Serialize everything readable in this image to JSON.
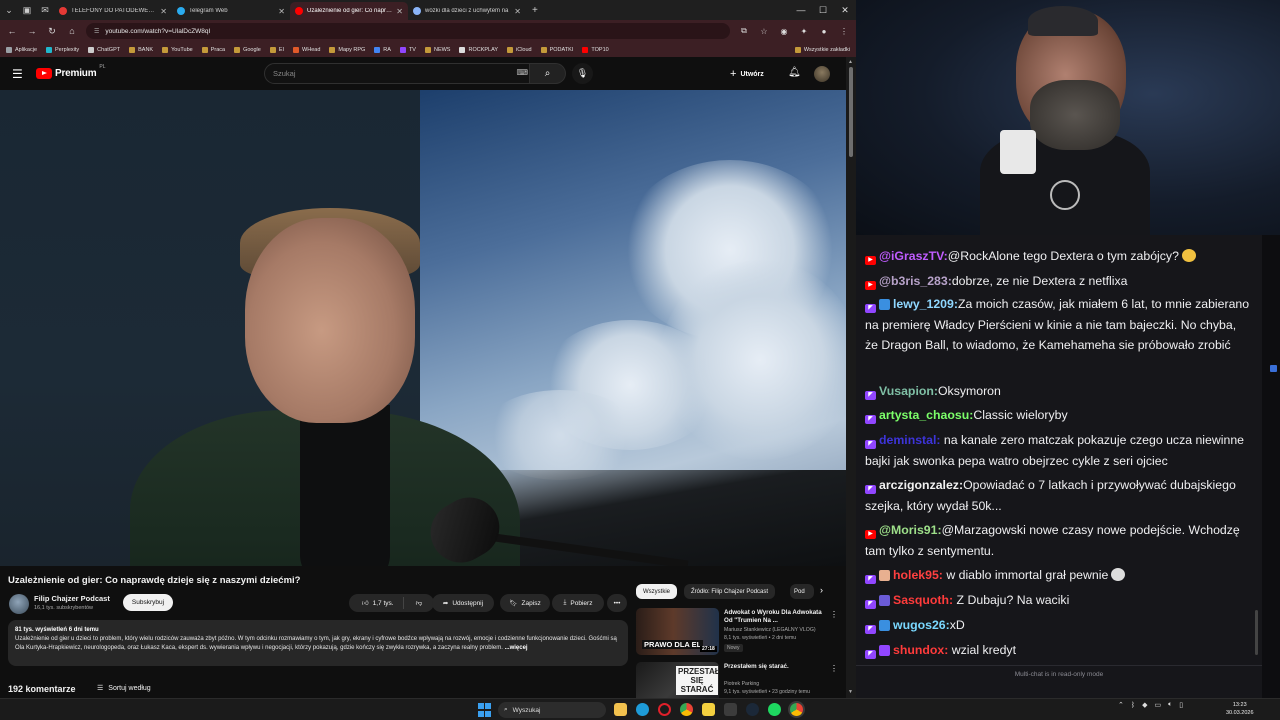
{
  "browser": {
    "tabs": [
      {
        "title": "TELEFONY DO PATODEWELOPERA",
        "color": "#e53935"
      },
      {
        "title": "Telegram Web",
        "color": "#2aabee"
      },
      {
        "title": "Uzależnienie od gier: Co naprawdę",
        "color": "#ff0000"
      },
      {
        "title": "wózki dla dzieci z uchwytem na",
        "color": "#8ab4f8"
      }
    ],
    "url": "youtube.com/watch?v=UlalDcZW8qI",
    "bookmarks": [
      {
        "label": "Aplikacje",
        "color": "#9aa0a6"
      },
      {
        "label": "Perplexity",
        "color": "#20b8cd"
      },
      {
        "label": "ChatGPT",
        "color": "#cccccc"
      },
      {
        "label": "BANK",
        "color": "#c49a3a"
      },
      {
        "label": "YouTube",
        "color": "#c49a3a"
      },
      {
        "label": "Praca",
        "color": "#c49a3a"
      },
      {
        "label": "Google",
        "color": "#c49a3a"
      },
      {
        "label": "EI",
        "color": "#c49a3a"
      },
      {
        "label": "WHead",
        "color": "#e05a2a"
      },
      {
        "label": "Mapy RPG",
        "color": "#c49a3a"
      },
      {
        "label": "RA",
        "color": "#4285f4"
      },
      {
        "label": "TV",
        "color": "#9146ff"
      },
      {
        "label": "NEWS",
        "color": "#c49a3a"
      },
      {
        "label": "ROCKPLAY",
        "color": "#dddddd"
      },
      {
        "label": "iCloud",
        "color": "#c49a3a"
      },
      {
        "label": "PODATKI",
        "color": "#c49a3a"
      },
      {
        "label": "TOP10",
        "color": "#ff0000"
      }
    ],
    "all_bookmarks": "Wszystkie zakładki"
  },
  "youtube": {
    "logo": "Premium",
    "logo_cc": "PL",
    "search_placeholder": "Szukaj",
    "create_label": "Utwórz",
    "video": {
      "title": "Uzależnienie od gier: Co naprawdę dzieje się z naszymi dziećmi?",
      "channel": "Filip Chajzer Podcast",
      "subscribers": "16,1 tys. subskrybentów",
      "subscribe_label": "Subskrybuj",
      "likes": "1,7 tys.",
      "share_label": "Udostępnij",
      "save_label": "Zapisz",
      "download_label": "Pobierz",
      "more_label": "•••",
      "description_meta": "81 tys. wyświetleń  6 dni temu",
      "description_text": "Uzależnienie od gier u dzieci to problem, który wielu rodziców zauważa zbyt późno. W tym odcinku rozmawiamy o tym, jak gry, ekrany i cyfrowe bodźce wpływają na rozwój, emocje i codzienne funkcjonowanie dzieci. Gośćmi są Ola Kurtyka-Hrapkiewicz, neurologopeda, oraz Łukasz Kaca, ekspert ds. wywierania wpływu i negocjacji, którzy pokazują, gdzie kończy się zwykła rozrywka, a zaczyna realny problem.",
      "description_more": "...więcej",
      "comments": "192 komentarze",
      "sort_label": "Sortuj według"
    },
    "chips": [
      "Wszystkie",
      "Źródło: Filip Chajzer Podcast",
      "Pod"
    ],
    "related": [
      {
        "title": "Adwokat o Wyroku Dla Adwokata Od \"Trumien Na ...",
        "channel": "Mariusz Stankiewicz (LEGALNY VLOG)",
        "views": "8,1 tys. wyświetleń  •  2 dni temu",
        "badge": "Nowy",
        "thumb_text": "PRAWO DLA EL",
        "duration": "27:18"
      },
      {
        "title": "Przestałem się starać.",
        "channel": "Piotrek Parking",
        "views": "9,1 tys. wyświetleń  •  23 godziny temu",
        "badge": "",
        "thumb_text": "PRZESTAŁEM SIĘ STARAĆ"
      }
    ]
  },
  "chat": {
    "messages": [
      {
        "platform": "yt",
        "user": "@iGraszTV:",
        "color": "#c05cff",
        "text": "@RockAlone tego Dextera o tym zabójcy?",
        "emote": "#f0c040"
      },
      {
        "platform": "yt",
        "user": "@b3ris_283:",
        "color": "#b7a2c9",
        "text": "dobrze, ze nie Dextera z netflixa"
      },
      {
        "platform": "tw",
        "user": "lewy_1209:",
        "color": "#8fd7ff",
        "text": "Za moich czasów, jak miałem 6 lat, to mnie zabierano na premierę Władcy Pierścieni w kinie a nie tam bajeczki. No chyba, że Dragon Ball, to wiadomo, że Kamehameha sie próbowało zrobić"
      },
      {
        "platform": "tw",
        "user": "Vusapion:",
        "color": "#7fbfa5",
        "text": "Oksymoron"
      },
      {
        "platform": "tw",
        "user": "artysta_chaosu:",
        "color": "#7cff6a",
        "text": "Classic wieloryby"
      },
      {
        "platform": "tw",
        "user": "deminstal:",
        "color": "#3d34d9",
        "text": "na kanale zero matczak pokazuje czego ucza niewinne bajki jak swonka pepa watro obejrzec cykle z seri ojciec"
      },
      {
        "platform": "tw",
        "user": "arczigonzalez:",
        "color": "#f1f1f1",
        "text": "Opowiadać o 7 latkach i przywoływać dubajskiego szejka, który wydał 50k..."
      },
      {
        "platform": "yt",
        "user": "@Moris91:",
        "color": "#9ee08a",
        "text": "@Marzagowski nowe czasy nowe podejście. Wchodzę tam tylko z sentymentu."
      },
      {
        "platform": "tw",
        "user": "holek95:",
        "color": "#ff4040",
        "text": "w diablo immortal grał pewnie",
        "badge": "#e8b090",
        "emote": "#dddddd"
      },
      {
        "platform": "tw",
        "user": "Sasquoth:",
        "color": "#ff3b3b",
        "text": "Z Dubaju? Na waciki",
        "badge": "#6b5bd6"
      },
      {
        "platform": "tw",
        "user": "wugos26:",
        "color": "#7ad8ff",
        "text": "xD",
        "badge": "#3a8fe0"
      },
      {
        "platform": "tw",
        "user": "shundox:",
        "color": "#ff3b3b",
        "text": "wzial kredyt",
        "badge": "#9146ff"
      }
    ],
    "footer": "Multi-chat is in read-only mode"
  },
  "taskbar": {
    "search_placeholder": "Wyszukaj",
    "time": "13:23",
    "date": "30.03.2026"
  }
}
